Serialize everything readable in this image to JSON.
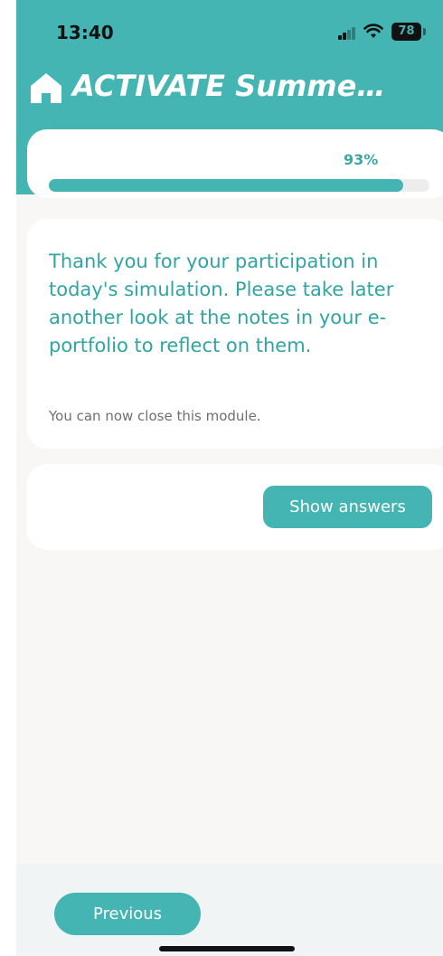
{
  "status_bar": {
    "time": "13:40",
    "battery": "78"
  },
  "header": {
    "title": "ACTIVATE Summe…",
    "icon": "home-icon"
  },
  "progress": {
    "label": "93%",
    "value": 0.93
  },
  "message": {
    "text": "Thank you for your participation in today's simulation. Please take later another look at the notes in your e-portfolio to reflect on them.",
    "subtext": "You can now close this module."
  },
  "actions": {
    "show_answers_label": "Show answers",
    "previous_label": "Previous"
  },
  "colors": {
    "accent": "#44b5b2",
    "accent_text": "#2fa5a2",
    "background": "#f9f6f6"
  }
}
